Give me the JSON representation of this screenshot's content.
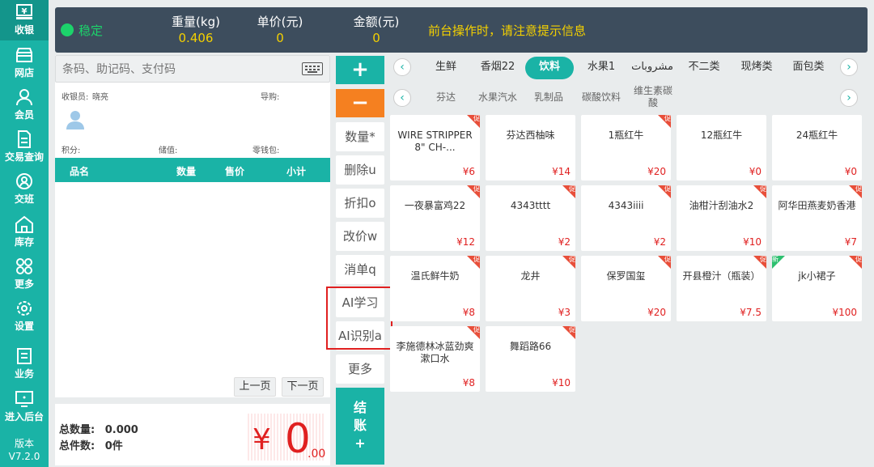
{
  "sidebar": {
    "items": [
      {
        "label": "收银",
        "icon": "cash-register-icon"
      },
      {
        "label": "网店",
        "icon": "store-icon"
      },
      {
        "label": "会员",
        "icon": "member-icon"
      },
      {
        "label": "交易查询",
        "icon": "document-icon"
      },
      {
        "label": "交班",
        "icon": "shift-icon"
      },
      {
        "label": "库存",
        "icon": "warehouse-icon"
      },
      {
        "label": "更多",
        "icon": "grid-icon"
      },
      {
        "label": "设置",
        "icon": "gear-icon"
      },
      {
        "label": "业务",
        "icon": "book-icon"
      },
      {
        "label": "进入后台",
        "icon": "monitor-icon"
      }
    ],
    "version_label": "版本",
    "version": "V7.2.0"
  },
  "topbar": {
    "status": "稳定",
    "weight_label": "重量(kg)",
    "weight_value": "0.406",
    "unit_price_label": "单价(元)",
    "unit_price_value": "0",
    "amount_label": "金额(元)",
    "amount_value": "0",
    "notice": "前台操作时，请注意提示信息"
  },
  "order": {
    "search_placeholder": "条码、助记码、支付码",
    "cashier_label": "收银员:",
    "cashier_name": "晓亮",
    "guide_label": "导购:",
    "points_label": "积分:",
    "stored_label": "储值:",
    "change_label": "零钱包:",
    "columns": [
      "品名",
      "数量",
      "售价",
      "小计"
    ],
    "prev_page": "上一页",
    "next_page": "下一页",
    "total_qty_label": "总数量:",
    "total_qty": "0.000",
    "total_items_label": "总件数:",
    "total_items": "0件",
    "total_currency": "¥",
    "total_int": "0",
    "total_dec": ".00"
  },
  "actions": {
    "plus": "+",
    "minus": "−",
    "quantity": "数量*",
    "delete": "删除u",
    "discount": "折扣o",
    "change_price": "改价w",
    "void_order": "消单q",
    "ai_learn": "AI学习",
    "ai_recognize": "AI识别a",
    "more": "更多",
    "checkout_1": "结",
    "checkout_2": "账",
    "checkout_3": "+"
  },
  "categories": [
    "生鲜",
    "香烟22",
    "饮料",
    "水果1",
    "مشروبات",
    "不二类",
    "现烤类",
    "面包类"
  ],
  "active_category": "饮料",
  "subcategories": [
    "芬达",
    "水果汽水",
    "乳制品",
    "碳酸饮料",
    "维生素碳酸"
  ],
  "promo_tag": "促",
  "new_tag": "新",
  "products": [
    {
      "name": "WIRE STRIPPER 8\" CH-...",
      "price": "¥6",
      "tag": "promo"
    },
    {
      "name": "芬达西柚味",
      "price": "¥14",
      "tag": ""
    },
    {
      "name": "1瓶红牛",
      "price": "¥20",
      "tag": "promo"
    },
    {
      "name": "12瓶红牛",
      "price": "¥0",
      "tag": ""
    },
    {
      "name": "24瓶红牛",
      "price": "¥0",
      "tag": ""
    },
    {
      "name": "一夜暴富鸡22",
      "price": "¥12",
      "tag": "promo"
    },
    {
      "name": "4343tttt",
      "price": "¥2",
      "tag": "promo"
    },
    {
      "name": "4343iiii",
      "price": "¥2",
      "tag": "promo"
    },
    {
      "name": "油柑汁刮油水2",
      "price": "¥10",
      "tag": "promo"
    },
    {
      "name": "阿华田燕麦奶香港",
      "price": "¥7",
      "tag": "promo"
    },
    {
      "name": "温氏鲜牛奶",
      "price": "¥8",
      "tag": "promo"
    },
    {
      "name": "龙井",
      "price": "¥3",
      "tag": "promo"
    },
    {
      "name": "保罗国玺",
      "price": "¥20",
      "tag": "promo"
    },
    {
      "name": "开县橙汁（瓶装）",
      "price": "¥7.5",
      "tag": "promo"
    },
    {
      "name": "jk小裙子",
      "price": "¥100",
      "tag": "both"
    },
    {
      "name": "李施德林冰蓝劲爽漱口水",
      "price": "¥8",
      "tag": "promo"
    },
    {
      "name": "舞蹈路66",
      "price": "¥10",
      "tag": "promo"
    }
  ],
  "colors": {
    "accent": "#1ab3a6",
    "orange": "#f58020",
    "price_red": "#e02020",
    "topbar": "#3d4d5d",
    "status_green": "#1cd36b",
    "notice_yellow": "#f4d000"
  }
}
